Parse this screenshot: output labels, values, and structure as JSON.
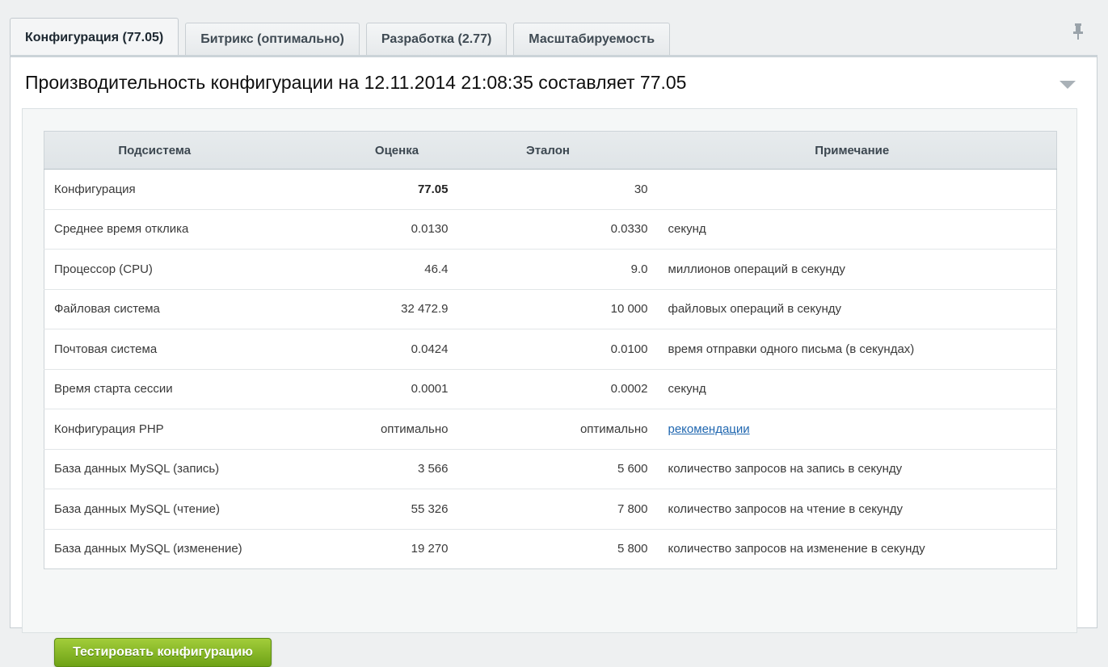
{
  "tabs": [
    {
      "label": "Конфигурация (77.05)",
      "active": true
    },
    {
      "label": "Битрикс (оптимально)",
      "active": false
    },
    {
      "label": "Разработка (2.77)",
      "active": false
    },
    {
      "label": "Масштабируемость",
      "active": false
    }
  ],
  "panel": {
    "title": "Производительность конфигурации на 12.11.2014 21:08:35 составляет 77.05"
  },
  "table": {
    "headers": [
      "Подсистема",
      "Оценка",
      "Эталон",
      "Примечание"
    ],
    "rows": [
      {
        "subsystem": "Конфигурация",
        "score": "77.05",
        "reference": "30",
        "note": ""
      },
      {
        "subsystem": "Среднее время отклика",
        "score": "0.0130",
        "reference": "0.0330",
        "note": "секунд"
      },
      {
        "subsystem": "Процессор (CPU)",
        "score": "46.4",
        "reference": "9.0",
        "note": "миллионов операций в секунду"
      },
      {
        "subsystem": "Файловая система",
        "score": "32 472.9",
        "reference": "10 000",
        "note": "файловых операций в секунду"
      },
      {
        "subsystem": "Почтовая система",
        "score": "0.0424",
        "reference": "0.0100",
        "note": "время отправки одного письма (в секундах)"
      },
      {
        "subsystem": "Время старта сессии",
        "score": "0.0001",
        "reference": "0.0002",
        "note": "секунд"
      },
      {
        "subsystem": "Конфигурация PHP",
        "score": "оптимально",
        "reference": "оптимально",
        "note": "рекомендации"
      },
      {
        "subsystem": "База данных MySQL (запись)",
        "score": "3 566",
        "reference": "5 600",
        "note": "количество запросов на запись в секунду"
      },
      {
        "subsystem": "База данных MySQL (чтение)",
        "score": "55 326",
        "reference": "7 800",
        "note": "количество запросов на чтение в секунду"
      },
      {
        "subsystem": "База данных MySQL (изменение)",
        "score": "19 270",
        "reference": "5 800",
        "note": "количество запросов на изменение в секунду"
      }
    ]
  },
  "actions": {
    "test_button_label": "Тестировать конфигурацию"
  },
  "icons": {
    "pin": "pin-icon",
    "collapse": "triangle-down-icon"
  },
  "colors": {
    "accent_button": "#7fb021",
    "link": "#2067b0"
  }
}
